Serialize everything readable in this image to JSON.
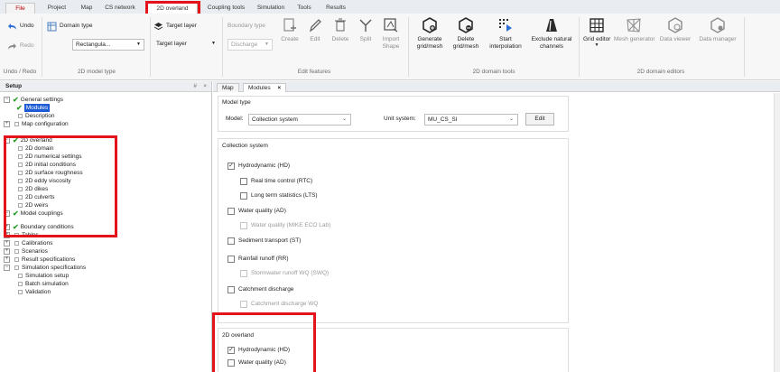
{
  "menu_tabs": [
    "File",
    "Project",
    "Map",
    "CS network",
    "2D overland",
    "Coupling tools",
    "Simulation",
    "Tools",
    "Results"
  ],
  "active_menu_tab": "2D overland",
  "ribbon": {
    "undo_label": "Undo",
    "redo_label": "Redo",
    "undo_group_label": "Undo / Redo",
    "domain_type_label": "Domain type",
    "domain_type_value": "Rectangula...",
    "model_type_group_label": "2D model type",
    "target_layer_label": "Target layer",
    "target_layer_value": "Target layer",
    "boundary_type_label": "Boundary type",
    "boundary_type_value": "Discharge",
    "create_label": "Create",
    "edit_label": "Edit",
    "delete_label": "Delete",
    "split_label": "Split",
    "import_shape_label": "Import\nShape",
    "edit_features_group_label": "Edit features",
    "generate_label": "Generate\ngrid/mesh",
    "delete_mesh_label": "Delete\ngrid/mesh",
    "start_interp_label": "Start\ninterpolation",
    "exclude_label": "Exclude natural\nchannels",
    "domain_tools_group_label": "2D domain tools",
    "grid_editor_label": "Grid editor",
    "mesh_generator_label": "Mesh generator",
    "data_viewer_label": "Data viewer",
    "data_manager_label": "Data manager",
    "domain_editors_group_label": "2D domain editors"
  },
  "setup_panel": {
    "title": "Setup",
    "pin": "#",
    "close": "×",
    "tree": [
      {
        "label": "General settings",
        "type": "check-parent",
        "expander": "−"
      },
      {
        "label": "Modules",
        "type": "check-child",
        "selected": true
      },
      {
        "label": "Description",
        "type": "leaf"
      },
      {
        "label": "Map configuration",
        "type": "parent",
        "expander": "+"
      },
      {
        "label": "2D overland",
        "type": "check-parent",
        "expander": "−"
      },
      {
        "label": "2D domain",
        "type": "leaf"
      },
      {
        "label": "2D numerical settings",
        "type": "leaf"
      },
      {
        "label": "2D initial conditions",
        "type": "leaf"
      },
      {
        "label": "2D surface roughness",
        "type": "leaf"
      },
      {
        "label": "2D eddy viscosity",
        "type": "leaf"
      },
      {
        "label": "2D dikes",
        "type": "leaf"
      },
      {
        "label": "2D culverts",
        "type": "leaf"
      },
      {
        "label": "2D weirs",
        "type": "leaf"
      },
      {
        "label": "Model couplings",
        "type": "check-parent",
        "expander": "−"
      },
      {
        "label": "Boundary conditions",
        "type": "check-parent",
        "expander": "+"
      },
      {
        "label": "Tables",
        "type": "parent",
        "expander": "+"
      },
      {
        "label": "Calibrations",
        "type": "parent",
        "expander": "+"
      },
      {
        "label": "Scenarios",
        "type": "parent",
        "expander": "+"
      },
      {
        "label": "Result specifications",
        "type": "parent",
        "expander": "+"
      },
      {
        "label": "Simulation specifications",
        "type": "parent",
        "expander": "−"
      },
      {
        "label": "Simulation setup",
        "type": "leaf"
      },
      {
        "label": "Batch simulation",
        "type": "leaf"
      },
      {
        "label": "Validation",
        "type": "leaf"
      }
    ]
  },
  "doc_tabs": [
    {
      "label": "Map",
      "active": false
    },
    {
      "label": "Modules",
      "active": true,
      "close": "×"
    }
  ],
  "model_type": {
    "section_title": "Model type",
    "model_label": "Model:",
    "model_value": "Collection system",
    "unit_label": "Unit system:",
    "unit_value": "MU_CS_SI",
    "edit_button": "Edit"
  },
  "collection_system": {
    "section_title": "Collection system",
    "items": [
      {
        "label": "Hydrodynamic (HD)",
        "checked": true,
        "enabled": true,
        "indent": 0
      },
      {
        "label": "Real time control (RTC)",
        "checked": false,
        "enabled": true,
        "indent": 1
      },
      {
        "label": "Long term statistics (LTS)",
        "checked": false,
        "enabled": true,
        "indent": 1
      },
      {
        "label": "Water quality (AD)",
        "checked": false,
        "enabled": true,
        "indent": 0
      },
      {
        "label": "Water quality (MIKE ECO Lab)",
        "checked": false,
        "enabled": false,
        "indent": 1
      },
      {
        "label": "Sediment transport (ST)",
        "checked": false,
        "enabled": true,
        "indent": 0
      },
      {
        "label": "Rainfall runoff (RR)",
        "checked": false,
        "enabled": true,
        "indent": 0
      },
      {
        "label": "Stormwater runoff WQ (SWQ)",
        "checked": false,
        "enabled": false,
        "indent": 1
      },
      {
        "label": "Catchment discharge",
        "checked": false,
        "enabled": true,
        "indent": 0
      },
      {
        "label": "Catchment discharge WQ",
        "checked": false,
        "enabled": false,
        "indent": 1
      }
    ]
  },
  "overland_2d": {
    "section_title": "2D overland",
    "items": [
      {
        "label": "Hydrodynamic (HD)",
        "checked": true
      },
      {
        "label": "Water quality (AD)",
        "checked": false
      }
    ]
  },
  "colors": {
    "highlight_red": "#e3121b",
    "selection_blue": "#1d5bd6",
    "check_green": "#2a9d2a"
  }
}
